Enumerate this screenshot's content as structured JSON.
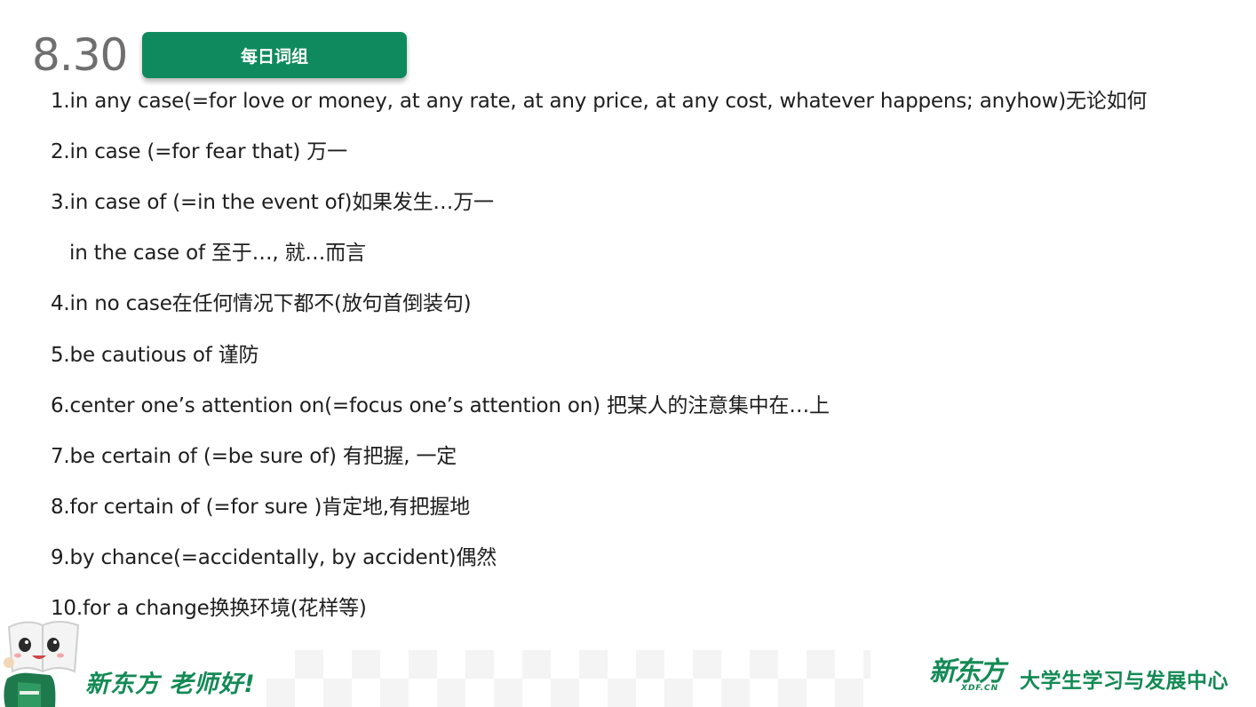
{
  "header": {
    "date": "8.30",
    "title": "每日词组"
  },
  "items": [
    "1.in any case(=for love or money, at any rate, at any price, at any cost, whatever happens; anyhow)无论如何",
    "2.in case (=for fear that) 万一",
    "3.in case of (=in the event of)如果发生…万一",
    "in the case of 至于…, 就…而言",
    "4.in no case在任何情况下都不(放句首倒装句)",
    "5.be cautious of 谨防",
    "6.center one’s attention on(=focus one’s attention on) 把某人的注意集中在…上",
    "7.be certain of (=be sure of) 有把握, 一定",
    "8.for certain of (=for sure )肯定地,有把握地",
    "9.by chance(=accidentally, by accident)偶然",
    "10.for a change换换环境(花样等)"
  ],
  "footer": {
    "slogan": "新东方 老师好!",
    "logo_main": "新东方",
    "logo_sub": "XDF.CN",
    "center_name": "大学生学习与发展中心"
  },
  "colors": {
    "brand_green": "#138a55",
    "badge_green": "#0f8a5f",
    "date_gray": "#6f6f6f"
  }
}
